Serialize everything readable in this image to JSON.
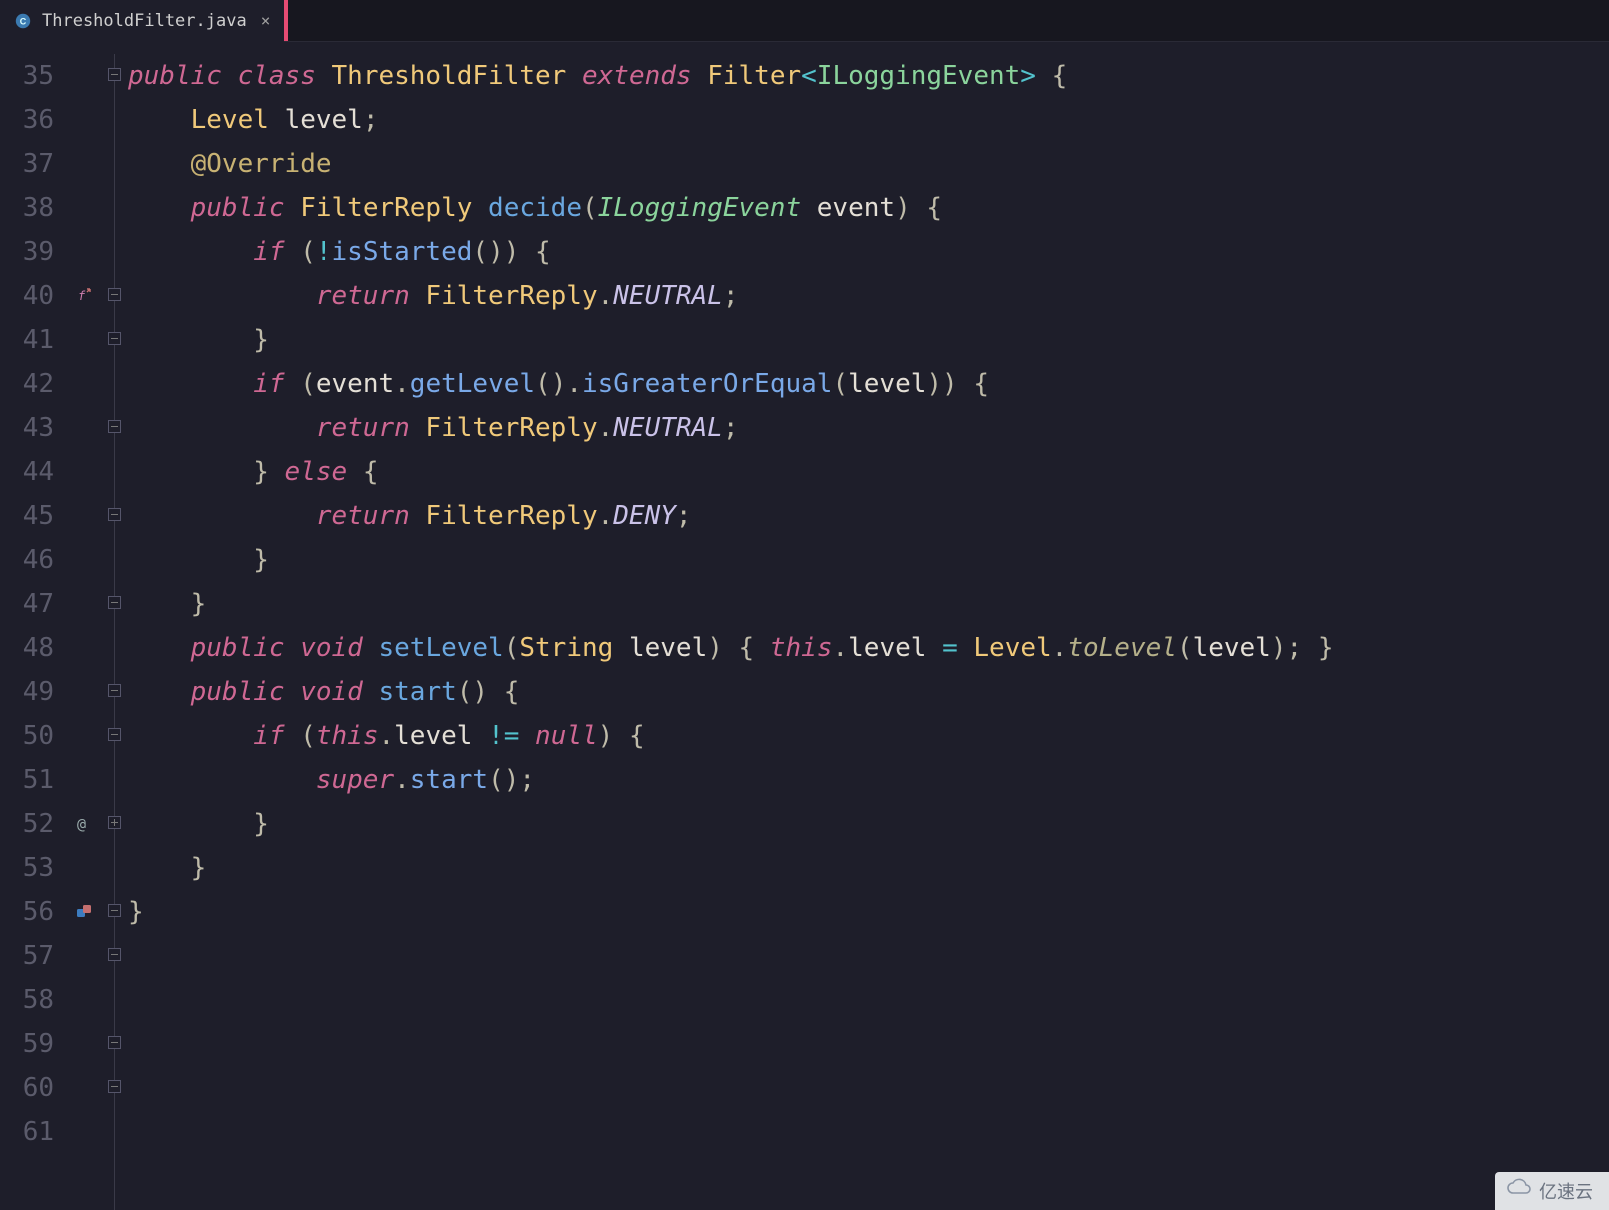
{
  "tab": {
    "filename": "ThresholdFilter.java",
    "fileicon": "java-class-icon"
  },
  "gutter": {
    "start": 35,
    "end": 61
  },
  "icons_by_line": {
    "40": "method-override-icon",
    "52": "annotation-icon",
    "56": "implement-icon"
  },
  "fold_by_line": {
    "35": "open",
    "40": "open",
    "41": "open",
    "43": "close",
    "45": "open",
    "47": "open",
    "49": "close",
    "50": "close",
    "52": "collapsed",
    "56": "open",
    "57": "open",
    "59": "close",
    "60": "close"
  },
  "code_tokens": {
    "35": [
      [
        "kw",
        "public"
      ],
      [
        "sp",
        " "
      ],
      [
        "kw",
        "class"
      ],
      [
        "sp",
        " "
      ],
      [
        "type",
        "ThresholdFilter"
      ],
      [
        "sp",
        " "
      ],
      [
        "kw",
        "extends"
      ],
      [
        "sp",
        " "
      ],
      [
        "type",
        "Filter"
      ],
      [
        "op",
        "<"
      ],
      [
        "typeG",
        "ILoggingEvent"
      ],
      [
        "op",
        ">"
      ],
      [
        "sp",
        " "
      ],
      [
        "pun",
        "{"
      ]
    ],
    "36": [],
    "37": [
      [
        "sp",
        "    "
      ],
      [
        "type",
        "Level"
      ],
      [
        "sp",
        " "
      ],
      [
        "id",
        "level"
      ],
      [
        "pun",
        ";"
      ]
    ],
    "38": [],
    "39": [
      [
        "sp",
        "    "
      ],
      [
        "ann",
        "@Override"
      ]
    ],
    "40": [
      [
        "sp",
        "    "
      ],
      [
        "kw",
        "public"
      ],
      [
        "sp",
        " "
      ],
      [
        "type",
        "FilterReply"
      ],
      [
        "sp",
        " "
      ],
      [
        "fnDecl",
        "decide"
      ],
      [
        "pun",
        "("
      ],
      [
        "typeI",
        "ILoggingEvent"
      ],
      [
        "sp",
        " "
      ],
      [
        "id",
        "event"
      ],
      [
        "pun",
        ")"
      ],
      [
        "sp",
        " "
      ],
      [
        "pun",
        "{"
      ]
    ],
    "41": [
      [
        "sp",
        "        "
      ],
      [
        "kw",
        "if"
      ],
      [
        "sp",
        " "
      ],
      [
        "pun",
        "("
      ],
      [
        "op",
        "!"
      ],
      [
        "fn",
        "isStarted"
      ],
      [
        "pun",
        "("
      ],
      [
        "pun",
        ")"
      ],
      [
        "pun",
        ")"
      ],
      [
        "sp",
        " "
      ],
      [
        "pun",
        "{"
      ]
    ],
    "42": [
      [
        "sp",
        "            "
      ],
      [
        "kw",
        "return"
      ],
      [
        "sp",
        " "
      ],
      [
        "type",
        "FilterReply"
      ],
      [
        "pun",
        "."
      ],
      [
        "stat",
        "NEUTRAL"
      ],
      [
        "pun",
        ";"
      ]
    ],
    "43": [
      [
        "sp",
        "        "
      ],
      [
        "pun",
        "}"
      ]
    ],
    "44": [],
    "45": [
      [
        "sp",
        "        "
      ],
      [
        "kw",
        "if"
      ],
      [
        "sp",
        " "
      ],
      [
        "pun",
        "("
      ],
      [
        "id",
        "event"
      ],
      [
        "pun",
        "."
      ],
      [
        "fn",
        "getLevel"
      ],
      [
        "pun",
        "("
      ],
      [
        "pun",
        ")"
      ],
      [
        "pun",
        "."
      ],
      [
        "fn",
        "isGreaterOrEqual"
      ],
      [
        "pun",
        "("
      ],
      [
        "id",
        "level"
      ],
      [
        "pun",
        ")"
      ],
      [
        "pun",
        ")"
      ],
      [
        "sp",
        " "
      ],
      [
        "pun",
        "{"
      ]
    ],
    "46": [
      [
        "sp",
        "            "
      ],
      [
        "kw",
        "return"
      ],
      [
        "sp",
        " "
      ],
      [
        "type",
        "FilterReply"
      ],
      [
        "pun",
        "."
      ],
      [
        "stat",
        "NEUTRAL"
      ],
      [
        "pun",
        ";"
      ]
    ],
    "47": [
      [
        "sp",
        "        "
      ],
      [
        "pun",
        "}"
      ],
      [
        "sp",
        " "
      ],
      [
        "kw",
        "else"
      ],
      [
        "sp",
        " "
      ],
      [
        "pun",
        "{"
      ]
    ],
    "48": [
      [
        "sp",
        "            "
      ],
      [
        "kw",
        "return"
      ],
      [
        "sp",
        " "
      ],
      [
        "type",
        "FilterReply"
      ],
      [
        "pun",
        "."
      ],
      [
        "stat",
        "DENY"
      ],
      [
        "pun",
        ";"
      ]
    ],
    "49": [
      [
        "sp",
        "        "
      ],
      [
        "pun",
        "}"
      ]
    ],
    "50": [
      [
        "sp",
        "    "
      ],
      [
        "pun",
        "}"
      ]
    ],
    "51": [],
    "52": [
      [
        "sp",
        "    "
      ],
      [
        "kw",
        "public"
      ],
      [
        "sp",
        " "
      ],
      [
        "kw",
        "void"
      ],
      [
        "sp",
        " "
      ],
      [
        "fnDecl",
        "setLevel"
      ],
      [
        "pun",
        "("
      ],
      [
        "type",
        "String"
      ],
      [
        "sp",
        " "
      ],
      [
        "id",
        "level"
      ],
      [
        "pun",
        ")"
      ],
      [
        "sp",
        " "
      ],
      [
        "pun",
        "{"
      ],
      [
        "sp",
        " "
      ],
      [
        "kw",
        "this"
      ],
      [
        "pun",
        "."
      ],
      [
        "id",
        "level"
      ],
      [
        "sp",
        " "
      ],
      [
        "op",
        "="
      ],
      [
        "sp",
        " "
      ],
      [
        "type",
        "Level"
      ],
      [
        "pun",
        "."
      ],
      [
        "toL",
        "toLevel"
      ],
      [
        "pun",
        "("
      ],
      [
        "id",
        "level"
      ],
      [
        "pun",
        ")"
      ],
      [
        "pun",
        ";"
      ],
      [
        "sp",
        " "
      ],
      [
        "pun",
        "}"
      ]
    ],
    "53": [],
    "56": [
      [
        "sp",
        "    "
      ],
      [
        "kw",
        "public"
      ],
      [
        "sp",
        " "
      ],
      [
        "kw",
        "void"
      ],
      [
        "sp",
        " "
      ],
      [
        "fnDecl",
        "start"
      ],
      [
        "pun",
        "("
      ],
      [
        "pun",
        ")"
      ],
      [
        "sp",
        " "
      ],
      [
        "pun",
        "{"
      ]
    ],
    "57": [
      [
        "sp",
        "        "
      ],
      [
        "kw",
        "if"
      ],
      [
        "sp",
        " "
      ],
      [
        "pun",
        "("
      ],
      [
        "kw",
        "this"
      ],
      [
        "pun",
        "."
      ],
      [
        "id",
        "level"
      ],
      [
        "sp",
        " "
      ],
      [
        "op",
        "!="
      ],
      [
        "sp",
        " "
      ],
      [
        "nul",
        "null"
      ],
      [
        "pun",
        ")"
      ],
      [
        "sp",
        " "
      ],
      [
        "pun",
        "{"
      ]
    ],
    "58": [
      [
        "sp",
        "            "
      ],
      [
        "kw",
        "super"
      ],
      [
        "pun",
        "."
      ],
      [
        "fn",
        "start"
      ],
      [
        "pun",
        "("
      ],
      [
        "pun",
        ")"
      ],
      [
        "pun",
        ";"
      ]
    ],
    "59": [
      [
        "sp",
        "        "
      ],
      [
        "pun",
        "}"
      ]
    ],
    "60": [
      [
        "sp",
        "    "
      ],
      [
        "pun",
        "}"
      ]
    ],
    "61": [
      [
        "pun",
        "}"
      ]
    ]
  },
  "visible_line_order": [
    35,
    36,
    37,
    38,
    39,
    40,
    41,
    42,
    43,
    44,
    45,
    46,
    47,
    48,
    49,
    50,
    51,
    52,
    53,
    56,
    57,
    58,
    59,
    60,
    61
  ],
  "watermark": {
    "text": "亿速云"
  },
  "colors": {
    "background": "#1e1e2a",
    "tab_accent": "#e64b73",
    "keyword": "#cf6893",
    "type": "#f0c97a",
    "function": "#7aa9e8",
    "string_type": "#8bd49c",
    "operator": "#53c3cd"
  }
}
